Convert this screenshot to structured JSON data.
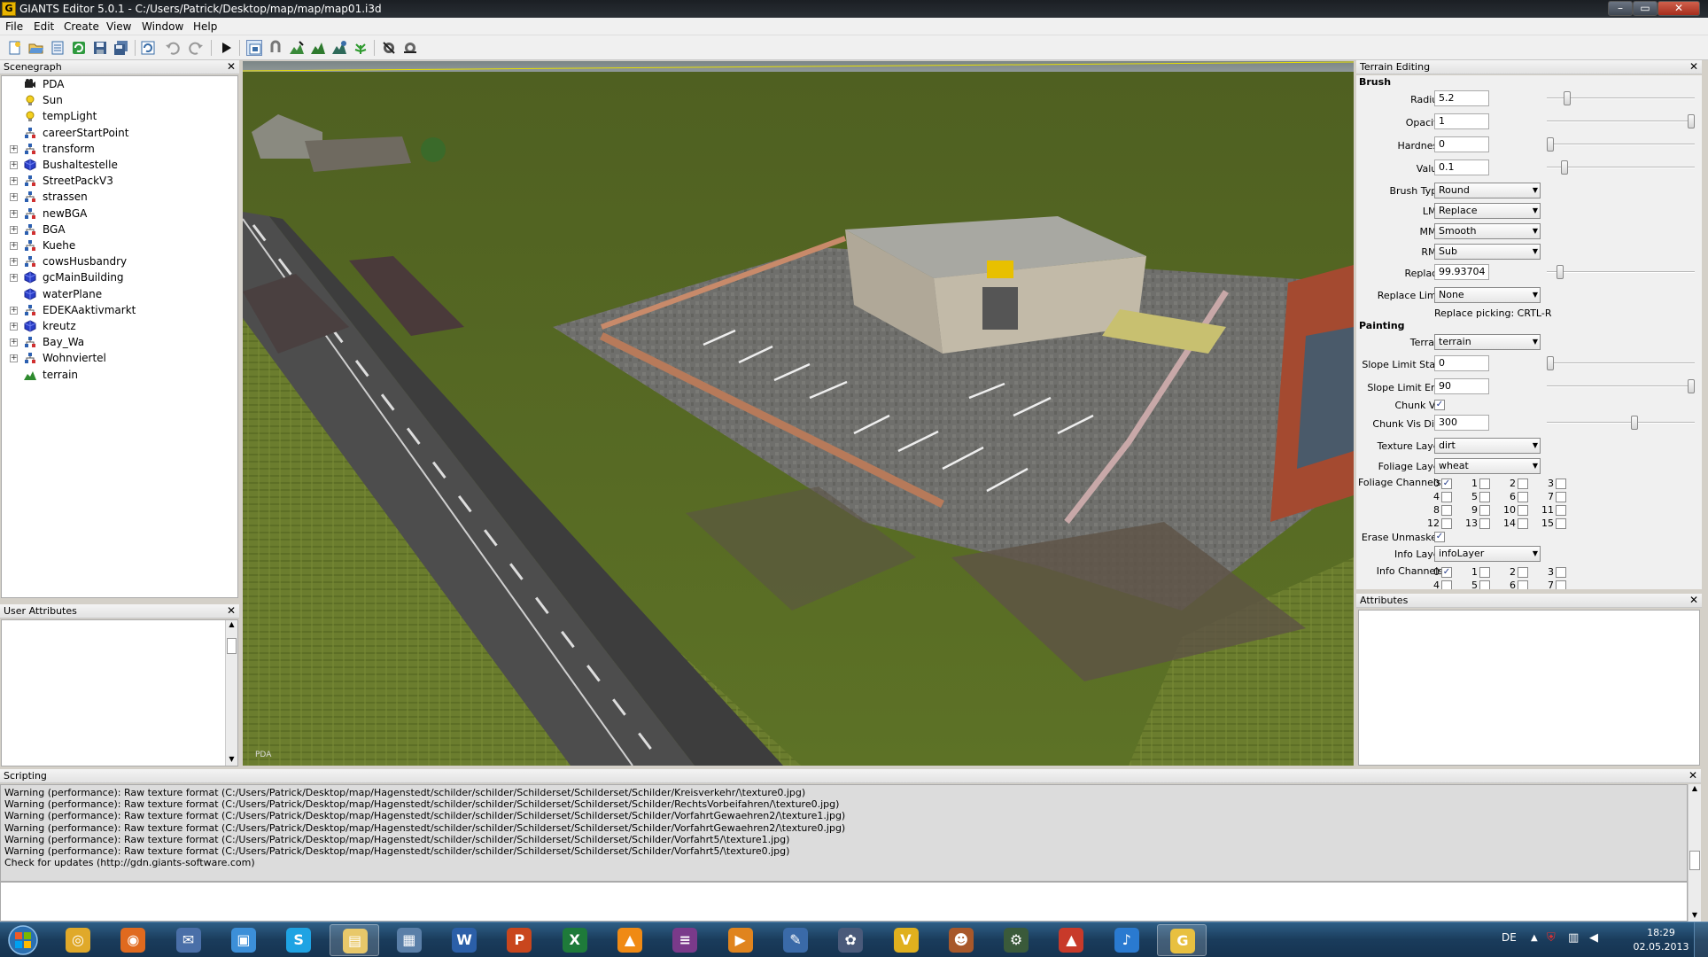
{
  "window": {
    "title": "GIANTS Editor 5.0.1 - C:/Users/Patrick/Desktop/map/map/map01.i3d",
    "app_icon": "G"
  },
  "menu": [
    "File",
    "Edit",
    "Create",
    "View",
    "Window",
    "Help"
  ],
  "toolbar": [
    "new-icon",
    "open-icon",
    "import-icon",
    "reload-icon",
    "save-icon",
    "save-all-icon",
    "undo-history-icon",
    "undo-icon",
    "redo-icon",
    "play-icon",
    "select-icon",
    "move-icon",
    "terrain-sculpt-icon",
    "terrain-paint-icon",
    "terrain-smooth-icon",
    "foliage-paint-icon",
    "settings-icon",
    "settings2-icon"
  ],
  "scenegraph": {
    "title": "Scenegraph",
    "items": [
      {
        "label": "PDA",
        "icon": "camera-icon",
        "expandable": false
      },
      {
        "label": "Sun",
        "icon": "light-icon",
        "expandable": false
      },
      {
        "label": "tempLight",
        "icon": "light-icon",
        "expandable": false
      },
      {
        "label": "careerStartPoint",
        "icon": "transform-icon",
        "expandable": false
      },
      {
        "label": "transform",
        "icon": "transform-icon",
        "expandable": true
      },
      {
        "label": "Bushaltestelle",
        "icon": "shape-icon",
        "expandable": true
      },
      {
        "label": "StreetPackV3",
        "icon": "transform-icon",
        "expandable": true
      },
      {
        "label": "strassen",
        "icon": "transform-icon",
        "expandable": true
      },
      {
        "label": "newBGA",
        "icon": "transform-icon",
        "expandable": true
      },
      {
        "label": "BGA",
        "icon": "transform-icon",
        "expandable": true
      },
      {
        "label": "Kuehe",
        "icon": "transform-icon",
        "expandable": true
      },
      {
        "label": "cowsHusbandry",
        "icon": "transform-icon",
        "expandable": true
      },
      {
        "label": "gcMainBuilding",
        "icon": "shape-icon",
        "expandable": true
      },
      {
        "label": "waterPlane",
        "icon": "shape-icon",
        "expandable": false
      },
      {
        "label": "EDEKAaktivmarkt",
        "icon": "transform-icon",
        "expandable": true
      },
      {
        "label": "kreutz",
        "icon": "shape-icon",
        "expandable": true
      },
      {
        "label": "Bay_Wa",
        "icon": "transform-icon",
        "expandable": true
      },
      {
        "label": "Wohnviertel",
        "icon": "transform-icon",
        "expandable": true
      },
      {
        "label": "terrain",
        "icon": "terrain-icon",
        "expandable": false
      }
    ]
  },
  "user_attributes": {
    "title": "User Attributes"
  },
  "viewport": {
    "camera_label": "PDA"
  },
  "terrain_editing": {
    "title": "Terrain Editing",
    "brush_section": "Brush",
    "radius": {
      "label": "Radius",
      "value": "5.2",
      "level": 0.12
    },
    "opacity": {
      "label": "Opacity",
      "value": "1",
      "level": 1.0
    },
    "hardness": {
      "label": "Hardness",
      "value": "0",
      "level": 0.0
    },
    "value": {
      "label": "Value",
      "value": "0.1",
      "level": 0.1
    },
    "brush_type": {
      "label": "Brush Type",
      "value": "Round"
    },
    "lmb": {
      "label": "LMB",
      "value": "Replace"
    },
    "mmb": {
      "label": "MMB",
      "value": "Smooth"
    },
    "rmb": {
      "label": "RMB",
      "value": "Sub"
    },
    "replace": {
      "label": "Replace",
      "value": "99.93704",
      "level": 0.07
    },
    "replace_limit": {
      "label": "Replace Limit",
      "value": "None"
    },
    "replace_picking": "Replace picking: CRTL-R",
    "painting_section": "Painting",
    "terrain": {
      "label": "Terrain",
      "value": "terrain"
    },
    "slope_start": {
      "label": "Slope Limit Start",
      "value": "0",
      "level": 0.0
    },
    "slope_end": {
      "label": "Slope Limit End",
      "value": "90",
      "level": 1.0
    },
    "chunk_vis": {
      "label": "Chunk Vis",
      "checked": true
    },
    "chunk_vis_dist": {
      "label": "Chunk Vis Dist",
      "value": "300",
      "level": 0.6
    },
    "texture_layer": {
      "label": "Texture Layer",
      "value": "dirt"
    },
    "foliage_layer": {
      "label": "Foliage Layer",
      "value": "wheat"
    },
    "foliage_channels": {
      "label": "Foliage Channels",
      "channels": [
        {
          "n": "0",
          "checked": true
        },
        {
          "n": "1",
          "checked": false
        },
        {
          "n": "2",
          "checked": false
        },
        {
          "n": "3",
          "checked": false
        },
        {
          "n": "4",
          "checked": false
        },
        {
          "n": "5",
          "checked": false
        },
        {
          "n": "6",
          "checked": false
        },
        {
          "n": "7",
          "checked": false
        },
        {
          "n": "8",
          "checked": false
        },
        {
          "n": "9",
          "checked": false
        },
        {
          "n": "10",
          "checked": false
        },
        {
          "n": "11",
          "checked": false
        },
        {
          "n": "12",
          "checked": false
        },
        {
          "n": "13",
          "checked": false
        },
        {
          "n": "14",
          "checked": false
        },
        {
          "n": "15",
          "checked": false
        }
      ]
    },
    "erase_unmasked": {
      "label": "Erase Unmasked",
      "checked": true
    },
    "info_layer": {
      "label": "Info Layer",
      "value": "infoLayer"
    },
    "info_channels": {
      "label": "Info Channels",
      "channels": [
        {
          "n": "0",
          "checked": true
        },
        {
          "n": "1",
          "checked": false
        },
        {
          "n": "2",
          "checked": false
        },
        {
          "n": "3",
          "checked": false
        },
        {
          "n": "4",
          "checked": false
        },
        {
          "n": "5",
          "checked": false
        },
        {
          "n": "6",
          "checked": false
        },
        {
          "n": "7",
          "checked": false
        }
      ]
    }
  },
  "attributes": {
    "title": "Attributes"
  },
  "scripting": {
    "title": "Scripting",
    "lines": [
      "Warning (performance): Raw texture format (C:/Users/Patrick/Desktop/map/Hagenstedt/schilder/schilder/Schilderset/Schilderset/Schilder/Kreisverkehr/\\texture0.jpg)",
      "Warning (performance): Raw texture format (C:/Users/Patrick/Desktop/map/Hagenstedt/schilder/schilder/Schilderset/Schilderset/Schilder/RechtsVorbeifahren/\\texture0.jpg)",
      "Warning (performance): Raw texture format (C:/Users/Patrick/Desktop/map/Hagenstedt/schilder/schilder/Schilderset/Schilderset/Schilder/VorfahrtGewaehren2/\\texture1.jpg)",
      "Warning (performance): Raw texture format (C:/Users/Patrick/Desktop/map/Hagenstedt/schilder/schilder/Schilderset/Schilderset/Schilder/VorfahrtGewaehren2/\\texture0.jpg)",
      "Warning (performance): Raw texture format (C:/Users/Patrick/Desktop/map/Hagenstedt/schilder/schilder/Schilderset/Schilderset/Schilder/Vorfahrt5/\\texture1.jpg)",
      "Warning (performance): Raw texture format (C:/Users/Patrick/Desktop/map/Hagenstedt/schilder/schilder/Schilderset/Schilderset/Schilder/Vorfahrt5/\\texture0.jpg)",
      "Check for updates (http://gdn.giants-software.com)"
    ]
  },
  "taskbar": {
    "apps": [
      {
        "name": "chrome-icon",
        "color": "#e0a92a",
        "glyph": "◎"
      },
      {
        "name": "firefox-icon",
        "color": "#e06a1f",
        "glyph": "◉"
      },
      {
        "name": "thunderbird-icon",
        "color": "#4a6fa8",
        "glyph": "✉"
      },
      {
        "name": "tv-icon",
        "color": "#3c8fd8",
        "glyph": "▣"
      },
      {
        "name": "skype-icon",
        "color": "#1fa3e3",
        "glyph": "S"
      },
      {
        "name": "explorer-folder-icon",
        "color": "#e8c86a",
        "glyph": "▤"
      },
      {
        "name": "remote-desktop-icon",
        "color": "#5a7fa8",
        "glyph": "▦"
      },
      {
        "name": "word-icon",
        "color": "#2b5fa8",
        "glyph": "W"
      },
      {
        "name": "powerpoint-icon",
        "color": "#c9461d",
        "glyph": "P"
      },
      {
        "name": "excel-icon",
        "color": "#1e7a3a",
        "glyph": "X"
      },
      {
        "name": "vlc-icon",
        "color": "#f08a14",
        "glyph": "▲"
      },
      {
        "name": "winrar-icon",
        "color": "#7a3a8a",
        "glyph": "≡"
      },
      {
        "name": "media-player-icon",
        "color": "#e0841e",
        "glyph": "▶"
      },
      {
        "name": "network-icon",
        "color": "#3a6aa8",
        "glyph": "✎"
      },
      {
        "name": "settings-app-icon",
        "color": "#4a5a7a",
        "glyph": "✿"
      },
      {
        "name": "v-app-icon",
        "color": "#e0b01e",
        "glyph": "V"
      },
      {
        "name": "game-avatar-icon",
        "color": "#a8582a",
        "glyph": "☻"
      },
      {
        "name": "tractor-icon",
        "color": "#3a5a3a",
        "glyph": "⚙"
      },
      {
        "name": "farming-simulator-icon",
        "color": "#c83a2a",
        "glyph": "▲"
      },
      {
        "name": "itunes-icon",
        "color": "#2a7ad0",
        "glyph": "♪"
      },
      {
        "name": "giants-editor-icon",
        "color": "#e8c040",
        "glyph": "G"
      }
    ],
    "language": "DE",
    "time": "18:29",
    "date": "02.05.2013"
  }
}
